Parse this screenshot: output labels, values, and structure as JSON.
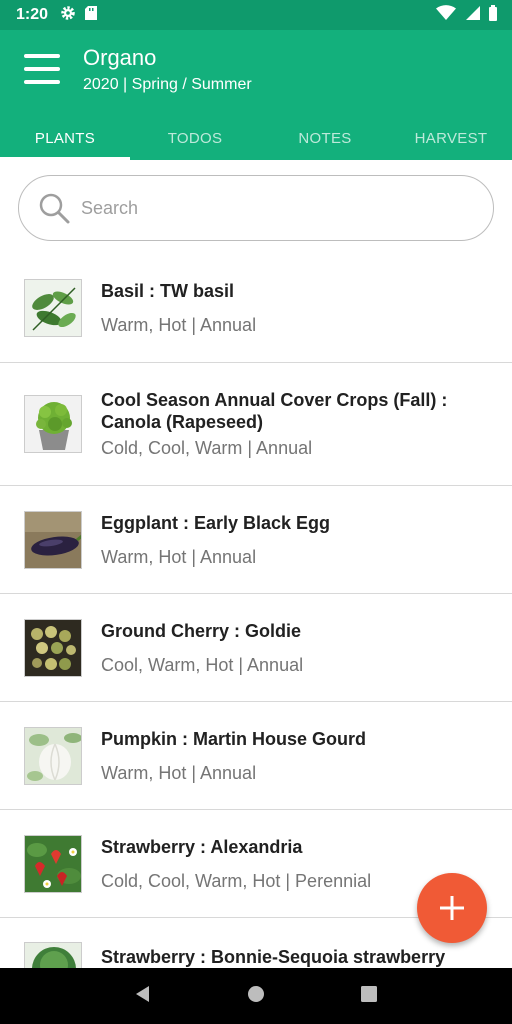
{
  "status_bar": {
    "time": "1:20",
    "icons": [
      "gear-icon",
      "sd-card-icon",
      "wifi-icon",
      "signal-icon",
      "battery-icon"
    ]
  },
  "app_bar": {
    "title": "Organo",
    "subtitle": "2020 | Spring / Summer",
    "color": "#13b07c"
  },
  "tabs": [
    {
      "label": "PLANTS",
      "active": true
    },
    {
      "label": "TODOS",
      "active": false
    },
    {
      "label": "NOTES",
      "active": false
    },
    {
      "label": "HARVEST",
      "active": false
    }
  ],
  "search": {
    "placeholder": "Search",
    "value": ""
  },
  "plants": [
    {
      "name": "Basil : TW basil",
      "meta": "Warm, Hot | Annual",
      "thumb": "basil-leaves"
    },
    {
      "name": "Cool Season Annual Cover Crops (Fall) : Canola (Rapeseed)",
      "meta": "Cold, Cool, Warm | Annual",
      "thumb": "potted-greens"
    },
    {
      "name": "Eggplant : Early Black Egg",
      "meta": "Warm, Hot | Annual",
      "thumb": "eggplant"
    },
    {
      "name": "Ground Cherry : Goldie",
      "meta": "Cool, Warm, Hot | Annual",
      "thumb": "ground-cherries"
    },
    {
      "name": "Pumpkin : Martin House Gourd",
      "meta": "Warm, Hot | Annual",
      "thumb": "white-gourd"
    },
    {
      "name": "Strawberry : Alexandria",
      "meta": "Cold, Cool, Warm, Hot | Perennial",
      "thumb": "strawberries"
    },
    {
      "name": "Strawberry : Bonnie-Sequoia strawberry",
      "meta": "",
      "thumb": "strawberry-plant"
    }
  ],
  "fab": {
    "icon": "plus-icon",
    "color": "#f05a36"
  },
  "nav_bar": {
    "icons": [
      "back-icon",
      "home-icon",
      "recents-icon"
    ]
  }
}
